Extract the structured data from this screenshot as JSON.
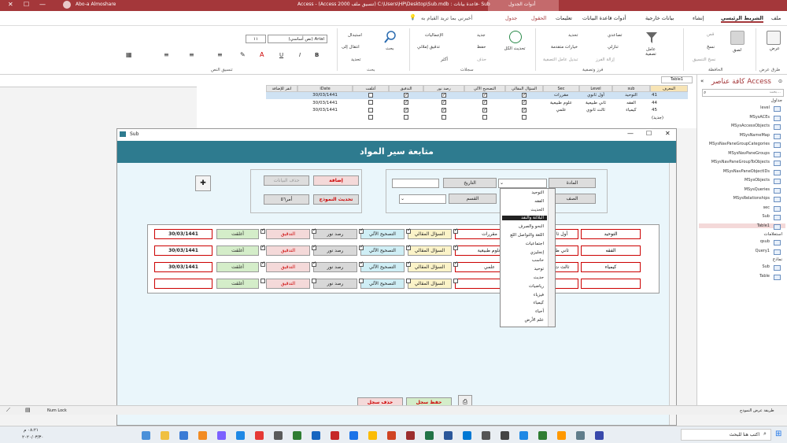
{
  "window": {
    "title": "Access - (Access 2000 تنسيق ملف) C:\\Users\\HP\\Desktop\\Sub.mdb : قاعدة بيانات- Sub",
    "context_tab": "أدوات الجدول",
    "user": "Abo-a Almoshare"
  },
  "menu": {
    "items": [
      "ملف",
      "الشريط الرئيسي",
      "إنشاء",
      "بيانات خارجية",
      "أدوات قاعدة البيانات",
      "تعليمات",
      "الحقول",
      "جدول"
    ],
    "tell_me": "أخبرني بما تريد القيام به"
  },
  "ribbon": {
    "views": {
      "label": "عرض",
      "group": "طرق عرض"
    },
    "clipboard": {
      "paste": "لصق",
      "cut": "قص",
      "copy": "نسخ",
      "format_painter": "نسخ التنسيق",
      "group": "الحافظة"
    },
    "sort": {
      "filter": "عامل تصفية",
      "ascending": "تصاعدي",
      "descending": "تنازلي",
      "remove_sort": "إزالة الفرز",
      "selection": "تحديد",
      "advanced": "خيارات متقدمة",
      "toggle_filter": "تبديل عامل التصفية",
      "group": "فرز وتصفية"
    },
    "records": {
      "refresh": "تحديث الكل",
      "new": "جديد",
      "save": "حفظ",
      "delete": "حذف",
      "totals": "الإجماليات",
      "spelling": "تدقيق إملائي",
      "more": "أكثر",
      "group": "سجلات"
    },
    "find": {
      "find": "بحث",
      "replace": "استبدال",
      "goto": "انتقال إلى",
      "select": "تحديد",
      "group": "بحث"
    },
    "text": {
      "font": "(نص أساسي) Arial",
      "size": "١١",
      "group": "تنسيق النص"
    }
  },
  "nav": {
    "title": "كافة عناصر Access",
    "search_placeholder": "بحث...",
    "sections": [
      {
        "header": "جداول",
        "items": [
          "level",
          "MSysACEs",
          "MSysAccessObjects",
          "MSysNameMap",
          "MSysNavPaneGroupCategories",
          "MSysNavPaneGroups",
          "MSysNavPaneGroupToObjects",
          "MSysNavPaneObjectIDs",
          "MSysObjects",
          "MSysQueries",
          "MSysRelationships",
          "sec",
          "Sub",
          "Table1"
        ]
      },
      {
        "header": "استعلامات",
        "items": [
          "qsub",
          "Query1"
        ]
      },
      {
        "header": "نماذج",
        "items": [
          "Sub",
          "Table"
        ]
      }
    ]
  },
  "table1": {
    "tab": "Table1",
    "columns": [
      "المعرف",
      "sub",
      "Level",
      "Sec",
      "السؤال المقالي",
      "التصحيح الآلي",
      "رصد نور",
      "التدقيق",
      "أغلقت",
      "iDate",
      "انقر للإضافة"
    ],
    "rows": [
      {
        "id": "41",
        "sub": "التوحيد",
        "level": "أول ثانوي",
        "sec": "مقررات",
        "c": [
          1,
          1,
          1,
          1,
          0
        ],
        "date": "30/03/1441"
      },
      {
        "id": "44",
        "sub": "الفقه",
        "level": "ثاني طبيعية",
        "sec": "علوم طبيعية",
        "c": [
          1,
          1,
          1,
          1,
          0
        ],
        "date": "30/03/1441"
      },
      {
        "id": "45",
        "sub": "كيمياء",
        "level": "ثالث ثانوي",
        "sec": "علمي",
        "c": [
          1,
          1,
          1,
          1,
          0
        ],
        "date": "30/03/1441"
      },
      {
        "id": "(جديد)",
        "sub": "",
        "level": "",
        "sec": "",
        "c": [
          0,
          0,
          0,
          0,
          0
        ],
        "date": ""
      }
    ]
  },
  "form": {
    "window_title": "Sub",
    "header": "متابعة سير المواد",
    "buttons": {
      "subject": "المادة",
      "grade": "الصف",
      "date": "التاريخ",
      "section": "القسم",
      "add": "إضافة",
      "delete_data": "حذف البيانات",
      "update_form": "تحديث النموذج",
      "count": "أمر٥٦",
      "save_record": "حفظ سجل",
      "delete_record": "حذف سجل"
    },
    "dropdown": [
      "التوحيد",
      "الفقه",
      "الحديث",
      "البلاغة والنقد",
      "النحو والصرف",
      "اللغة والتواصل اللغ",
      "اجتماعيات",
      "إنجليزي",
      "حاسب",
      "توحيد",
      "حديث",
      "رياضيات",
      "فيزياء",
      "كيمياء",
      "أحياء",
      "علم الأرض"
    ],
    "dropdown_selected": 3,
    "rows": [
      {
        "sub": "التوحيد",
        "level": "أول ثا",
        "sec": "مقررات",
        "essay": "السؤال المقالي",
        "auto": "التصحيح الآلي",
        "noor": "رصد نور",
        "audit": "التدقيق",
        "closed": "أغلقت",
        "date": "30/03/1441",
        "c": [
          1,
          1,
          1,
          1,
          1
        ]
      },
      {
        "sub": "الفقه",
        "level": "ثاني ط",
        "sec": "علوم طبيعية",
        "essay": "السؤال المقالي",
        "auto": "التصحيح الآلي",
        "noor": "رصد نور",
        "audit": "التدقيق",
        "closed": "أغلقت",
        "date": "30/03/1441",
        "c": [
          1,
          1,
          1,
          1,
          1
        ]
      },
      {
        "sub": "كيمياء",
        "level": "ثالث ث",
        "sec": "علمي",
        "essay": "السؤال المقالي",
        "auto": "التصحيح الآلي",
        "noor": "رصد نور",
        "audit": "التدقيق",
        "closed": "أغلقت",
        "date": "30/03/1441",
        "c": [
          1,
          1,
          1,
          1,
          1
        ]
      },
      {
        "sub": "",
        "level": "",
        "sec": "",
        "essay": "السؤال المقالي",
        "auto": "التصحيح الآلي",
        "noor": "رصد نور",
        "audit": "التدقيق",
        "closed": "أغلقت",
        "date": "",
        "c": [
          0,
          0,
          0,
          0,
          0
        ]
      }
    ]
  },
  "status": {
    "left": "طريقة عرض النموذج",
    "numlock": "Num Lock"
  },
  "taskbar": {
    "search": "اكتب هنا للبحث",
    "time": "٠٨:٢١ م",
    "date": "٢٠٢٠/٠٣/٣٠"
  },
  "colors": {
    "access_red": "#a4373a",
    "form_header": "#2e7b8f",
    "form_bg": "#eaf6fb"
  }
}
